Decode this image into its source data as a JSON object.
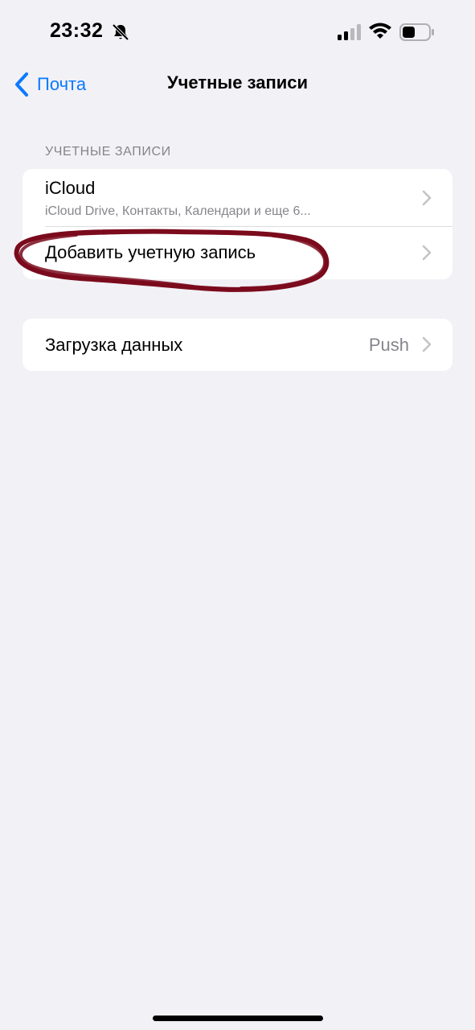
{
  "status_bar": {
    "time": "23:32",
    "icons": [
      "bell-slash-icon",
      "cellular-signal-icon",
      "wifi-icon",
      "battery-icon"
    ]
  },
  "nav": {
    "back_label": "Почта",
    "title": "Учетные записи"
  },
  "accounts_section": {
    "header": "УЧЕТНЫЕ ЗАПИСИ",
    "icloud": {
      "title": "iCloud",
      "subtitle": "iCloud Drive, Контакты, Календари и еще 6..."
    },
    "add_account": {
      "title": "Добавить учетную запись"
    }
  },
  "fetch_section": {
    "title": "Загрузка данных",
    "value": "Push"
  },
  "colors": {
    "accent": "#0a7aff",
    "background": "#f2f1f6",
    "annotation": "#7a0a1c",
    "secondary_text": "#86858b"
  }
}
